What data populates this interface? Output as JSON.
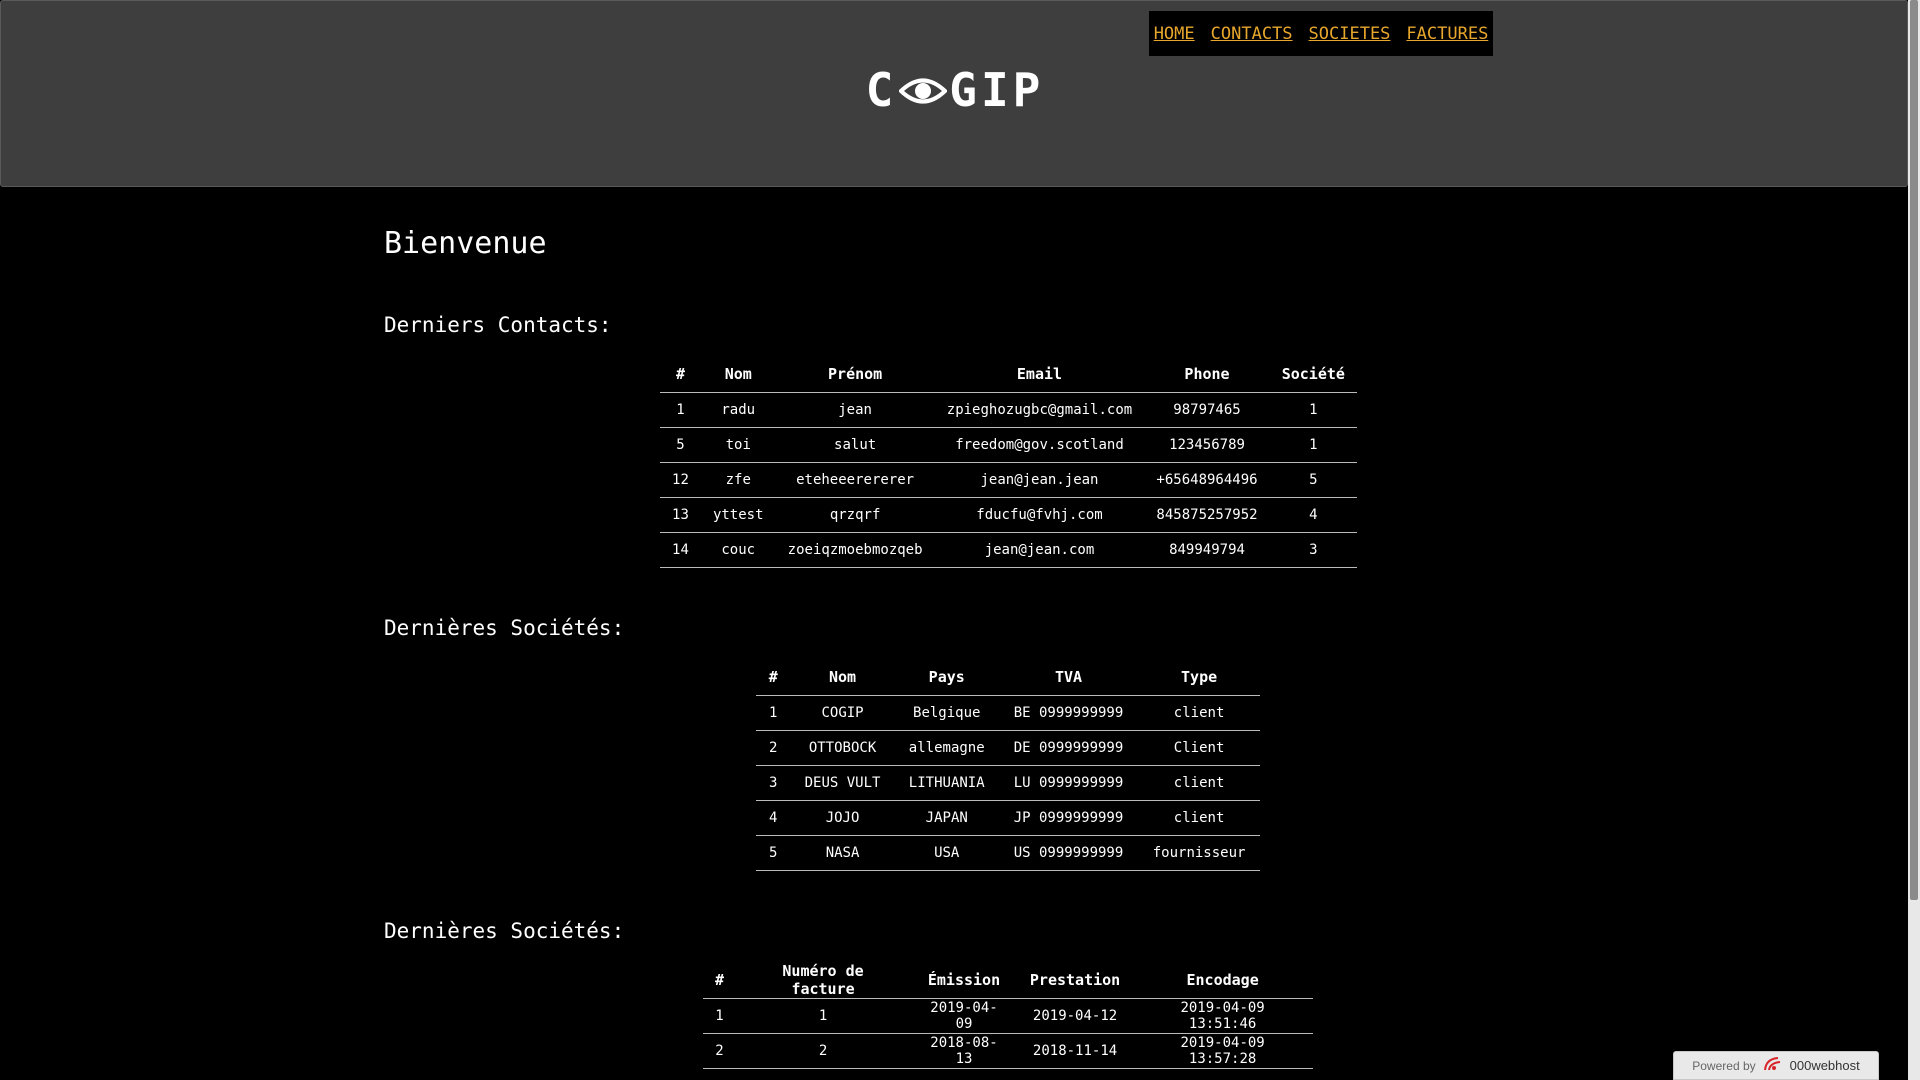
{
  "nav": [
    "HOME",
    "CONTACTS",
    "SOCIETES",
    "FACTURES"
  ],
  "logo": {
    "left": "C",
    "right": "GIP"
  },
  "welcome": "Bienvenue",
  "contacts": {
    "title": "Derniers Contacts:",
    "headers": [
      "#",
      "Nom",
      "Prénom",
      "Email",
      "Phone",
      "Société"
    ],
    "rows": [
      [
        "1",
        "radu",
        "jean",
        "zpieghozugbc@gmail.com",
        "98797465",
        "1"
      ],
      [
        "5",
        "toi",
        "salut",
        "freedom@gov.scotland",
        "123456789",
        "1"
      ],
      [
        "12",
        "zfe",
        "eteheeerererer",
        "jean@jean.jean",
        "+65648964496",
        "5"
      ],
      [
        "13",
        "yttest",
        "qrzqrf",
        "fducfu@fvhj.com",
        "845875257952",
        "4"
      ],
      [
        "14",
        "couc",
        "zoeiqzmoebmozqeb",
        "jean@jean.com",
        "849949794",
        "3"
      ]
    ]
  },
  "societes": {
    "title": "Dernières Sociétés:",
    "headers": [
      "#",
      "Nom",
      "Pays",
      "TVA",
      "Type"
    ],
    "rows": [
      [
        "1",
        "COGIP",
        "Belgique",
        "BE 0999999999",
        "client"
      ],
      [
        "2",
        "OTTOBOCK",
        "allemagne",
        "DE 0999999999",
        "Client"
      ],
      [
        "3",
        "DEUS VULT",
        "LITHUANIA",
        "LU 0999999999",
        "client"
      ],
      [
        "4",
        "JOJO",
        "JAPAN",
        "JP 0999999999",
        "client"
      ],
      [
        "5",
        "NASA",
        "USA",
        "US 0999999999",
        "fournisseur"
      ]
    ]
  },
  "factures": {
    "title": "Dernières Sociétés:",
    "headers": [
      "#",
      "Numéro de facture",
      "Émission",
      "Prestation",
      "Encodage"
    ],
    "rows": [
      [
        "1",
        "1",
        "2019-04-09",
        "2019-04-12",
        "2019-04-09 13:51:46"
      ],
      [
        "2",
        "2",
        "2018-08-13",
        "2018-11-14",
        "2019-04-09 13:57:28"
      ]
    ]
  },
  "badge": {
    "prefix": "Powered by",
    "brand": "000webhost"
  },
  "colors": {
    "header_bg": "#3e3e3e",
    "nav_link": "#e7a62c",
    "page_bg": "#000000"
  }
}
